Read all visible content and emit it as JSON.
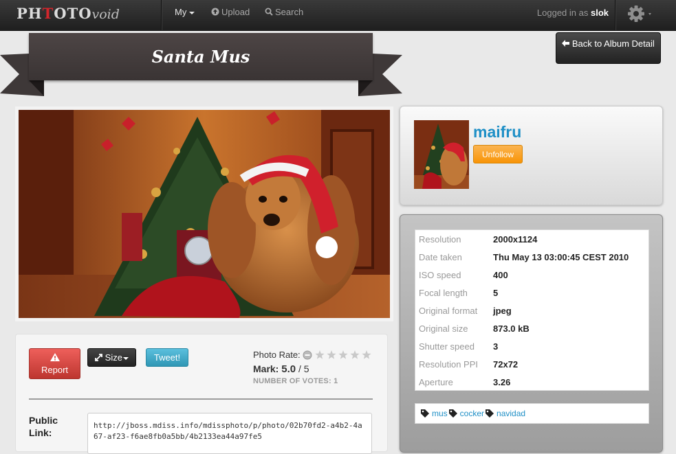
{
  "nav": {
    "logo": {
      "part1": "PH",
      "part2": "OTO",
      "part3": "void"
    },
    "my_label": "My",
    "upload_label": "Upload",
    "search_label": "Search",
    "logged_prefix": "Logged in as",
    "username": "slok"
  },
  "photo": {
    "title": "Santa Mus",
    "back_label": "Back to Album Detail"
  },
  "actions": {
    "report_label": "Report",
    "size_label": "Size",
    "tweet_label": "Tweet!"
  },
  "rating": {
    "label": "Photo Rate:",
    "mark_label": "Mark:",
    "mark_value": "5.0",
    "mark_max": "/ 5",
    "votes_text": "NUMBER OF VOTES: 1",
    "stars_filled": 0,
    "stars_total": 5
  },
  "public_link": {
    "label": "Public Link:",
    "value": "http://jboss.mdiss.info/mdissphoto/p/photo/02b70fd2-a4b2-4a67-af23-f6ae8fb0a5bb/4b2133ea44a97fe5"
  },
  "owner": {
    "name": "maifru",
    "unfollow_label": "Unfollow"
  },
  "metadata": [
    {
      "key": "Resolution",
      "value": "2000x1124"
    },
    {
      "key": "Date taken",
      "value": "Thu May 13 03:00:45 CEST 2010"
    },
    {
      "key": "ISO speed",
      "value": "400"
    },
    {
      "key": "Focal length",
      "value": "5"
    },
    {
      "key": "Original format",
      "value": "jpeg"
    },
    {
      "key": "Original size",
      "value": "873.0 kB"
    },
    {
      "key": "Shutter speed",
      "value": "3"
    },
    {
      "key": "Resolution PPI",
      "value": "72x72"
    },
    {
      "key": "Aperture",
      "value": "3.26"
    }
  ],
  "tags": [
    "mus",
    "cocker",
    "navidad"
  ],
  "colors": {
    "link": "#1e8fc6",
    "report": "#d9453e",
    "unfollow": "#f89406",
    "tweet": "#49afcd"
  }
}
